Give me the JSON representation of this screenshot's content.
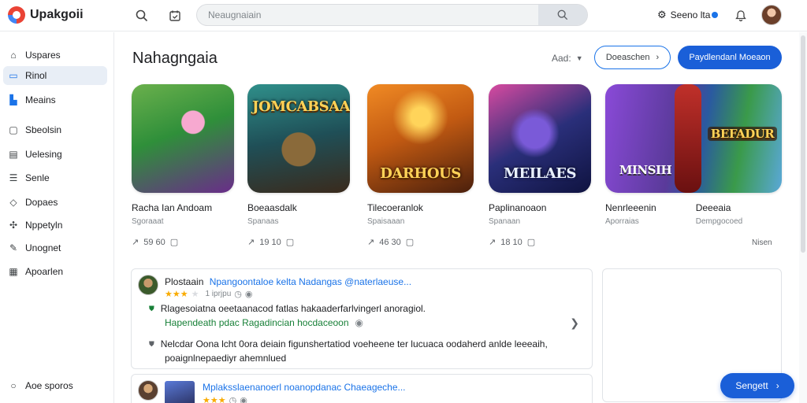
{
  "app": {
    "name": "Upakgoii"
  },
  "topbar": {
    "search_placeholder": "Neaugnaiain",
    "link_label": "Seeno lta"
  },
  "sidebar": {
    "items": [
      {
        "label": "Uspares",
        "icon": "home-icon"
      },
      {
        "label": "Rinol",
        "icon": "folder-icon",
        "active": true
      },
      {
        "label": "Meains",
        "icon": "chart-icon"
      },
      {
        "label": "Sbeolsin",
        "icon": "square-icon"
      },
      {
        "label": "Uelesing",
        "icon": "document-icon"
      },
      {
        "label": "Senle",
        "icon": "list-icon"
      },
      {
        "label": "Dopaes",
        "icon": "tag-icon"
      },
      {
        "label": "Nppetyln",
        "icon": "puzzle-icon"
      },
      {
        "label": "Unognet",
        "icon": "edit-icon"
      },
      {
        "label": "Apoarlen",
        "icon": "calendar-icon"
      }
    ],
    "footer_label": "Aoe sporos"
  },
  "main": {
    "title": "Nahagngaia",
    "sort_label": "Aad:",
    "outline_button": "Doeaschen",
    "primary_button": "Paydlendanl Moeaon",
    "more_link": "Nisen",
    "games": [
      {
        "name": "Racha Ian Andoam",
        "sub": "Sgoraaat",
        "stats": "59  60",
        "tile_text": "",
        "colors": [
          "#2f8f3a",
          "#6a2c8a"
        ]
      },
      {
        "name": "Boeaasdalk",
        "sub": "Spanaas",
        "stats": "19  10",
        "tile_text": "JOMCABSAAI",
        "colors": [
          "#1f4f57",
          "#3a2a1c"
        ]
      },
      {
        "name": "Tilecoeranlok",
        "sub": "Spaisaaan",
        "stats": "46  30",
        "tile_text": "DARHOUS",
        "colors": [
          "#c25a12",
          "#4a1f0c"
        ]
      },
      {
        "name": "Paplinanoaon",
        "sub": "Spanaan",
        "stats": "18  10",
        "tile_text": "MEILAES",
        "colors": [
          "#2a2f7a",
          "#7a2a6a"
        ]
      },
      {
        "name": "Nenrleeenin",
        "sub": "Aporraias",
        "stats": "",
        "tile_text": "MINSIH",
        "colors": [
          "#5a3a9a",
          "#2a5aa0"
        ]
      },
      {
        "name": "Deeeaia",
        "sub": "Dempgocoed",
        "stats": "",
        "tile_text": "BEFADUR",
        "colors": [
          "#2f7a3a",
          "#5aa8d8"
        ]
      }
    ],
    "reviews": [
      {
        "author": "Plostaain",
        "meta": "Npangoontaloe kelta  Nadangas @naterlaeuse...",
        "rating_time": "1 iprjpu",
        "lines": [
          {
            "text": "Rlagesoiatna oeetaanacod fatlas hakaaderfarlvingerl anoragiol.",
            "style": "normal",
            "bullet": "shield-icon"
          },
          {
            "text": "Hapendeath pdac Ragadincian hocdaceoon",
            "style": "green",
            "bullet": ""
          },
          {
            "text": "Nelcdar Oona lcht  0ora deiain figunshertatiod voeheene ter lucuaca oodaherd anlde leeeaih,",
            "style": "normal",
            "bullet": "shield-icon"
          },
          {
            "text": "poaignlnepaediyr ahemnlued",
            "style": "normal",
            "bullet": ""
          }
        ]
      },
      {
        "author": "",
        "meta": "Mplaksslaenanoerl noanopdanac  Chaeageche...",
        "rating_time": "",
        "lines": []
      }
    ]
  },
  "fab": {
    "label": "Sengett"
  }
}
